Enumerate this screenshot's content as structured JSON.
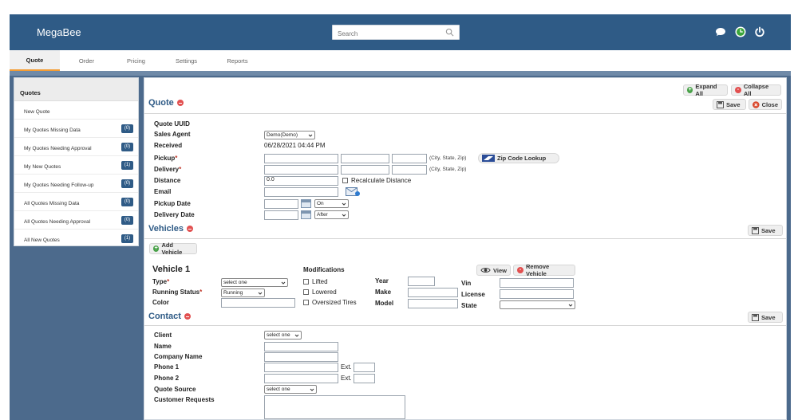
{
  "app": {
    "brand": "MegaBee"
  },
  "search": {
    "placeholder": "Search"
  },
  "tabs": [
    {
      "label": "Quote",
      "active": true
    },
    {
      "label": "Order"
    },
    {
      "label": "Pricing"
    },
    {
      "label": "Settings"
    },
    {
      "label": "Reports"
    }
  ],
  "sidebar": {
    "title": "Quotes",
    "items": [
      {
        "label": "New Quote",
        "count": ""
      },
      {
        "label": "My Quotes Missing Data",
        "count": "(0)"
      },
      {
        "label": "My Quotes Needing Approval",
        "count": "(0)"
      },
      {
        "label": "My New Quotes",
        "count": "(1)"
      },
      {
        "label": "My Quotes Needing Follow-up",
        "count": "(0)"
      },
      {
        "label": "All Quotes Missing Data",
        "count": "(0)"
      },
      {
        "label": "All Quotes Needing Approval",
        "count": "(0)"
      },
      {
        "label": "All New Quotes",
        "count": "(1)"
      }
    ]
  },
  "toolbar": {
    "expand_all": "Expand All",
    "collapse_all": "Collapse All",
    "save": "Save",
    "close": "Close"
  },
  "quote": {
    "title": "Quote",
    "uuid_label": "Quote UUID",
    "agent_label": "Sales Agent",
    "agent_value": "Demo(Demo)",
    "received_label": "Received",
    "received_value": "06/28/2021 04:44 PM",
    "pickup_label": "Pickup",
    "delivery_label": "Delivery",
    "city_hint": "(City, State, Zip)",
    "zip_lookup": "Zip Code Lookup",
    "distance_label": "Distance",
    "distance_value": "0.0",
    "recalc_label": "Recalculate Distance",
    "email_label": "Email",
    "pickup_date_label": "Pickup Date",
    "pickup_date_mode": "On",
    "delivery_date_label": "Delivery Date",
    "delivery_date_mode": "After"
  },
  "vehicles": {
    "title": "Vehicles",
    "save": "Save",
    "add": "Add Vehicle",
    "vehicle_title": "Vehicle 1",
    "type_label": "Type",
    "type_value": "select one",
    "running_label": "Running Status",
    "running_value": "Running",
    "color_label": "Color",
    "mods_label": "Modifications",
    "mod_lifted": "Lifted",
    "mod_lowered": "Lowered",
    "mod_tires": "Oversized Tires",
    "year_label": "Year",
    "make_label": "Make",
    "model_label": "Model",
    "vin_label": "Vin",
    "license_label": "License",
    "state_label": "State",
    "view": "View",
    "remove": "Remove Vehicle"
  },
  "contact": {
    "title": "Contact",
    "save": "Save",
    "client_label": "Client",
    "client_value": "select one",
    "name_label": "Name",
    "company_label": "Company Name",
    "phone1_label": "Phone 1",
    "phone2_label": "Phone 2",
    "ext_label": "Ext.",
    "source_label": "Quote Source",
    "source_value": "select one",
    "requests_label": "Customer Requests"
  },
  "colors": {
    "header": "#2f5b86",
    "accent": "#f39c34",
    "required": "#c0392b"
  }
}
